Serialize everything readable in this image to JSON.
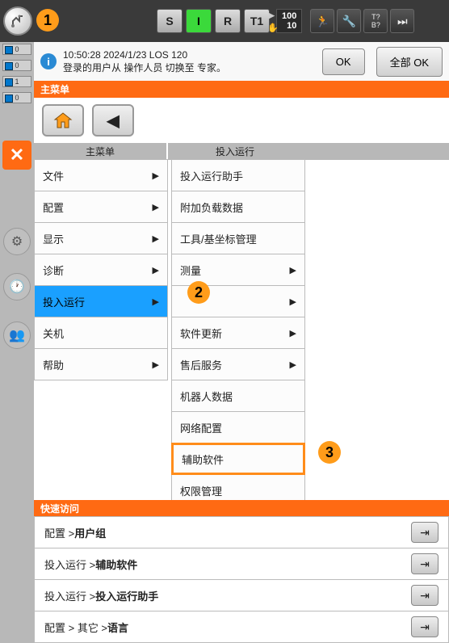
{
  "topbar": {
    "modes": [
      "S",
      "I",
      "R",
      "T1"
    ],
    "active_mode_index": 1,
    "speed_top": "100",
    "speed_bottom": "10",
    "t_label": "T?",
    "b_label": "B?"
  },
  "annotations": {
    "a1": "1",
    "a2": "2",
    "a3": "3"
  },
  "sidebar_slots": [
    "0",
    "0",
    "1",
    "0"
  ],
  "info": {
    "timestamp": "10:50:28 2024/1/23 LOS 120",
    "message": "登录的用户从 操作人员 切换至 专家。",
    "ok": "OK",
    "all_ok": "全部 OK"
  },
  "main": {
    "title": "主菜单",
    "col_headers": [
      "主菜单",
      "投入运行"
    ],
    "col1": [
      {
        "label": "文件",
        "arrow": true
      },
      {
        "label": "配置",
        "arrow": true
      },
      {
        "label": "显示",
        "arrow": true
      },
      {
        "label": "诊断",
        "arrow": true
      },
      {
        "label": "投入运行",
        "arrow": true,
        "selected": true
      },
      {
        "label": "关机",
        "arrow": false
      },
      {
        "label": "帮助",
        "arrow": true
      }
    ],
    "col2": [
      {
        "label": "投入运行助手",
        "arrow": false
      },
      {
        "label": "附加负载数据",
        "arrow": false
      },
      {
        "label": "工具/基坐标管理",
        "arrow": false
      },
      {
        "label": "测量",
        "arrow": true
      },
      {
        "label": "",
        "arrow": true
      },
      {
        "label": "软件更新",
        "arrow": true
      },
      {
        "label": "售后服务",
        "arrow": true
      },
      {
        "label": "机器人数据",
        "arrow": false
      },
      {
        "label": "网络配置",
        "arrow": false
      },
      {
        "label": "辅助软件",
        "arrow": false,
        "highlighted": true
      },
      {
        "label": "权限管理",
        "arrow": false
      }
    ]
  },
  "quick": {
    "title": "快速访问",
    "items": [
      {
        "prefix": "配置 > ",
        "label": "用户组"
      },
      {
        "prefix": "投入运行 > ",
        "label": "辅助软件"
      },
      {
        "prefix": "投入运行 > ",
        "label": "投入运行助手"
      },
      {
        "prefix": "配置 > 其它 > ",
        "label": "语言"
      }
    ]
  }
}
